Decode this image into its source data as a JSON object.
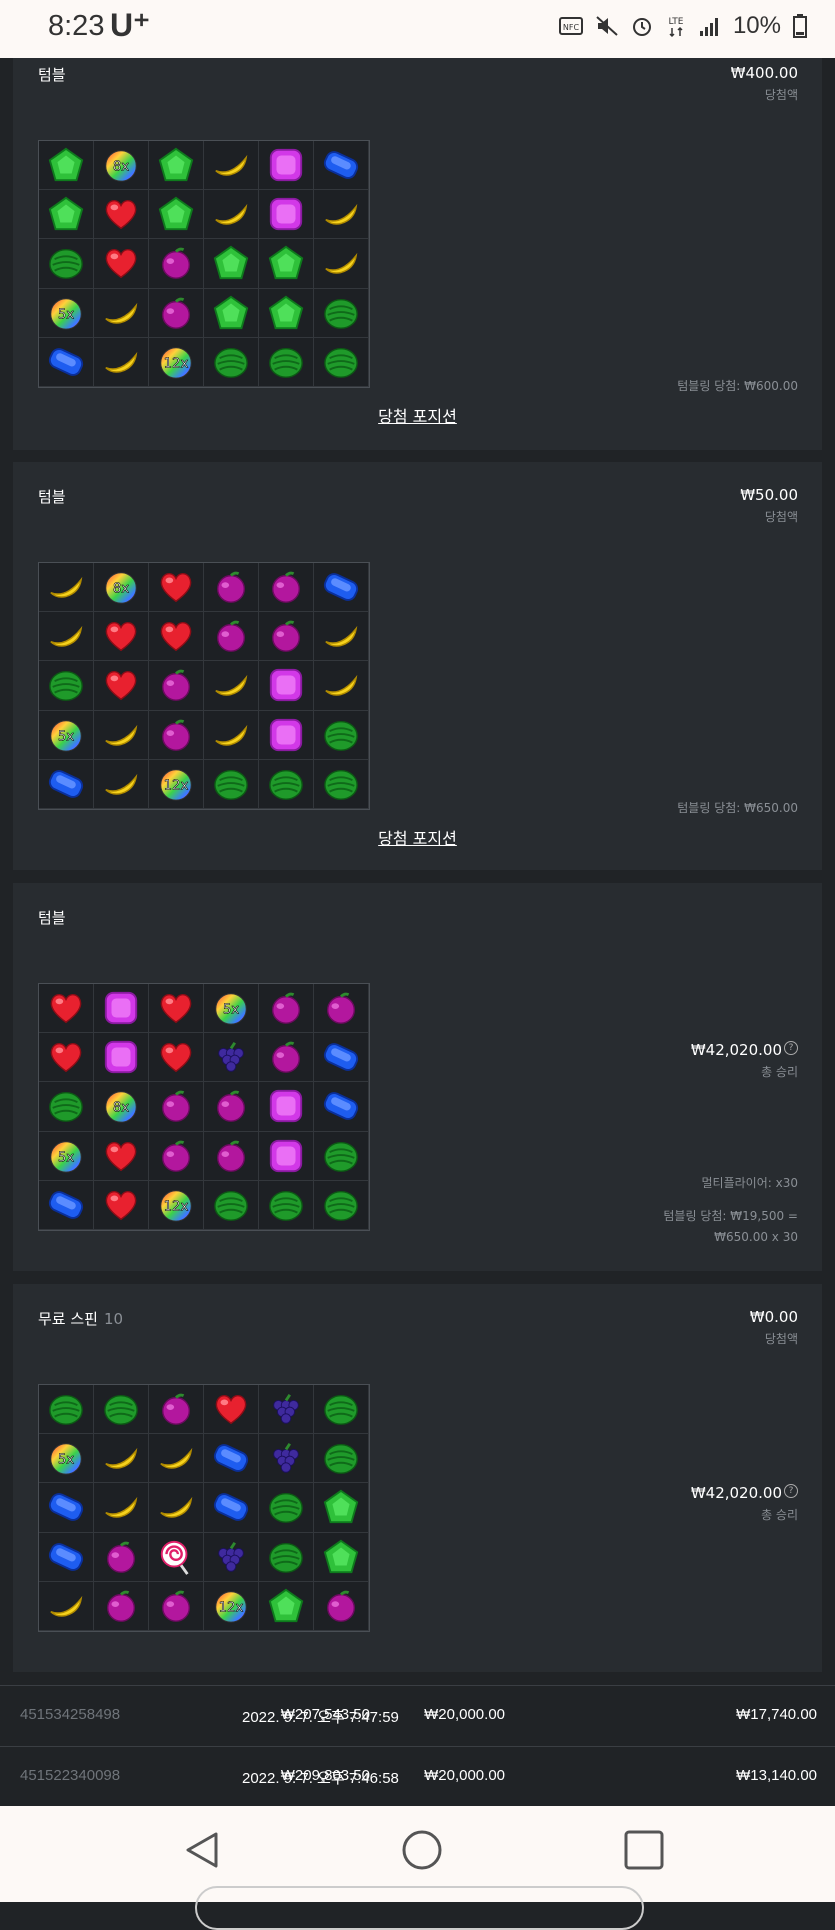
{
  "status_bar": {
    "time": "8:23",
    "carrier": "U⁺",
    "battery": "10%",
    "icons": [
      "nfc-icon",
      "mute-icon",
      "alarm-icon",
      "lte-icon",
      "signal-icon",
      "battery-icon"
    ]
  },
  "cards": [
    {
      "title": "텀블",
      "subtitle": "",
      "amount": "₩400.00",
      "amount_label": "당첨액",
      "info_lines": [
        "텀블링 당첨: ₩600.00"
      ],
      "link": "당첨 포지션",
      "grid": [
        [
          "green-pentagon",
          "bomb-8x",
          "green-pentagon",
          "banana",
          "purple-square",
          "blue-oval"
        ],
        [
          "green-pentagon",
          "heart",
          "green-pentagon",
          "banana",
          "purple-square",
          "banana"
        ],
        [
          "watermelon",
          "heart",
          "plum",
          "green-pentagon",
          "green-pentagon",
          "banana"
        ],
        [
          "bomb-5x",
          "banana",
          "plum",
          "green-pentagon",
          "green-pentagon",
          "watermelon"
        ],
        [
          "blue-oval",
          "banana",
          "bomb-12x",
          "watermelon",
          "watermelon",
          "watermelon"
        ]
      ]
    },
    {
      "title": "텀블",
      "subtitle": "",
      "amount": "₩50.00",
      "amount_label": "당첨액",
      "info_lines": [
        "텀블링 당첨: ₩650.00"
      ],
      "link": "당첨 포지션",
      "grid": [
        [
          "banana",
          "bomb-8x",
          "heart",
          "plum",
          "plum",
          "blue-oval"
        ],
        [
          "banana",
          "heart",
          "heart",
          "plum",
          "plum",
          "banana"
        ],
        [
          "watermelon",
          "heart",
          "plum",
          "banana",
          "purple-square",
          "banana"
        ],
        [
          "bomb-5x",
          "banana",
          "plum",
          "banana",
          "purple-square",
          "watermelon"
        ],
        [
          "blue-oval",
          "banana",
          "bomb-12x",
          "watermelon",
          "watermelon",
          "watermelon"
        ]
      ]
    },
    {
      "title": "텀블",
      "subtitle": "",
      "amount": "₩42,020.00",
      "amount_label": "총 승리",
      "info_lines": [
        "멀티플라이어: x30",
        "텀블링 당첨: ₩19,500 =",
        "₩650.00 x 30"
      ],
      "link": "",
      "grid": [
        [
          "heart",
          "purple-square",
          "heart",
          "bomb-5x",
          "plum",
          "plum"
        ],
        [
          "heart",
          "purple-square",
          "heart",
          "grapes",
          "plum",
          "blue-oval"
        ],
        [
          "watermelon",
          "bomb-8x",
          "plum",
          "plum",
          "purple-square",
          "blue-oval"
        ],
        [
          "bomb-5x",
          "heart",
          "plum",
          "plum",
          "purple-square",
          "watermelon"
        ],
        [
          "blue-oval",
          "heart",
          "bomb-12x",
          "watermelon",
          "watermelon",
          "watermelon"
        ]
      ]
    },
    {
      "title": "무료 스핀",
      "subtitle": "10",
      "amount": "₩0.00",
      "amount_label": "당첨액",
      "amount2": "₩42,020.00",
      "amount2_label": "총 승리",
      "info_lines": [],
      "link": "",
      "grid": [
        [
          "watermelon",
          "watermelon",
          "plum",
          "heart",
          "grapes",
          "watermelon"
        ],
        [
          "bomb-5x",
          "banana",
          "banana",
          "blue-oval",
          "grapes",
          "watermelon"
        ],
        [
          "blue-oval",
          "banana",
          "banana",
          "blue-oval",
          "watermelon",
          "green-pentagon"
        ],
        [
          "blue-oval",
          "plum",
          "lollipop",
          "grapes",
          "watermelon",
          "green-pentagon"
        ],
        [
          "banana",
          "plum",
          "plum",
          "bomb-12x",
          "green-pentagon",
          "plum"
        ]
      ]
    }
  ],
  "history_rows": [
    {
      "id": "451534258498",
      "date": "2022. 9. 7. 오후 7:47:59",
      "balance": "₩207,543.50",
      "bet": "₩20,000.00",
      "win": "₩17,740.00"
    },
    {
      "id": "451522340098",
      "date": "2022. 9. 7. 오후 7:46:58",
      "balance": "₩209,803.50",
      "bet": "₩20,000.00",
      "win": "₩13,140.00"
    }
  ],
  "nav": [
    "back-icon",
    "home-icon",
    "recents-icon"
  ]
}
